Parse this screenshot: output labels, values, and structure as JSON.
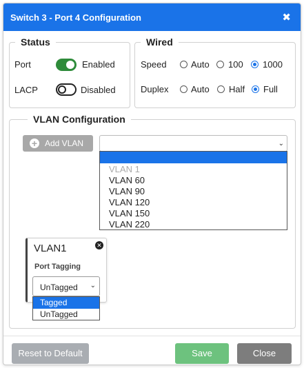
{
  "dialog": {
    "title": "Switch 3 - Port 4 Configuration",
    "close_glyph": "✖"
  },
  "status": {
    "legend": "Status",
    "port_label": "Port",
    "port_toggle_state": "on",
    "port_state_text": "Enabled",
    "lacp_label": "LACP",
    "lacp_toggle_state": "off",
    "lacp_state_text": "Disabled"
  },
  "wired": {
    "legend": "Wired",
    "speed_label": "Speed",
    "speed_options": [
      "Auto",
      "100",
      "1000"
    ],
    "speed_selected": "1000",
    "duplex_label": "Duplex",
    "duplex_options": [
      "Auto",
      "Half",
      "Full"
    ],
    "duplex_selected": "Full"
  },
  "vlan": {
    "legend": "VLAN Configuration",
    "add_button": "Add VLAN",
    "select_value": "",
    "options": [
      "VLAN 1",
      "VLAN 60",
      "VLAN 90",
      "VLAN 120",
      "VLAN 150",
      "VLAN 220"
    ],
    "disabled_option": "VLAN 1"
  },
  "vlan_card": {
    "name": "VLAN1",
    "tagging_label": "Port Tagging",
    "tagging_value": "UnTagged",
    "tagging_options": [
      "Tagged",
      "UnTagged"
    ],
    "tagging_highlighted": "Tagged"
  },
  "footer": {
    "reset_label": "Reset to Default",
    "save_label": "Save",
    "close_label": "Close"
  },
  "colors": {
    "accent": "#1a73e8",
    "toggle_on": "#2e8b3a",
    "save_button": "#6dc27e",
    "close_button": "#7d7d7d",
    "reset_button": "#a9adb2"
  }
}
